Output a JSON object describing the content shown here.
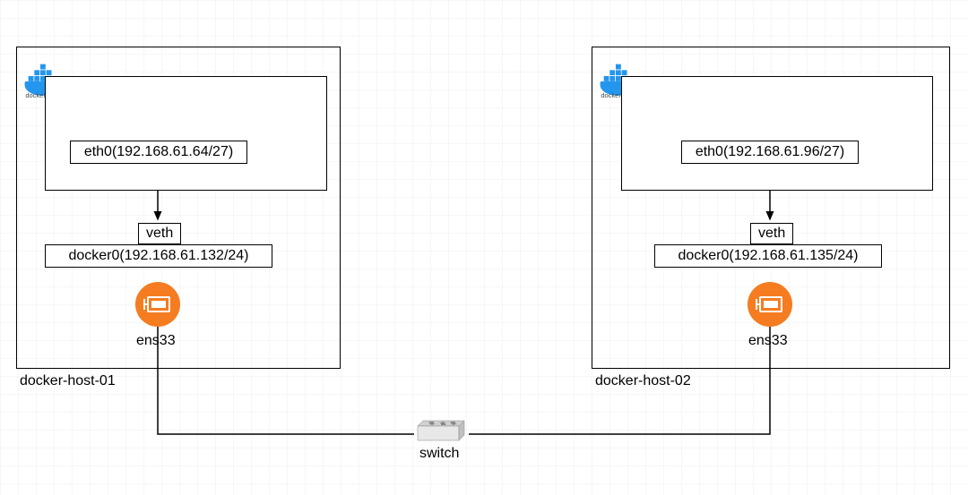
{
  "hosts": [
    {
      "name": "docker-host-01",
      "eth0": "eth0(192.168.61.64/27)",
      "veth": "veth",
      "docker0": "docker0(192.168.61.132/24)",
      "ens": "ens33"
    },
    {
      "name": "docker-host-02",
      "eth0": "eth0(192.168.61.96/27)",
      "veth": "veth",
      "docker0": "docker0(192.168.61.135/24)",
      "ens": "ens33"
    }
  ],
  "switch": {
    "label": "switch"
  },
  "docker_brand": "docker"
}
